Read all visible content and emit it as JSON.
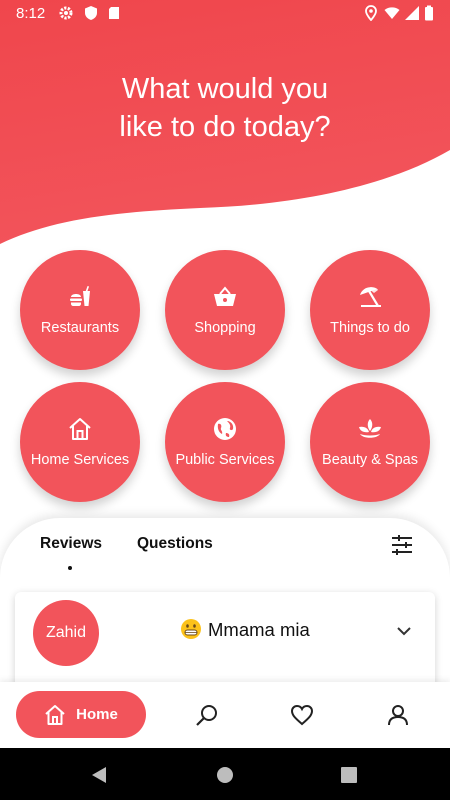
{
  "status_bar": {
    "time": "8:12"
  },
  "hero": {
    "title_line1": "What would you",
    "title_line2": "like to do today?",
    "color_top": "#f0464c",
    "color_bottom": "#f2545b"
  },
  "categories": [
    {
      "label": "Restaurants",
      "icon": "burger-drink-icon"
    },
    {
      "label": "Shopping",
      "icon": "shopping-basket-icon"
    },
    {
      "label": "Things to do",
      "icon": "beach-umbrella-icon"
    },
    {
      "label": "Home Services",
      "icon": "house-icon"
    },
    {
      "label": "Public Services",
      "icon": "globe-icon"
    },
    {
      "label": "Beauty & Spas",
      "icon": "lotus-icon"
    }
  ],
  "tabs": {
    "reviews": "Reviews",
    "questions": "Questions",
    "active": "Reviews"
  },
  "review": {
    "author": "Zahid",
    "title": "Mmama mia",
    "emoji": "grinning-face-icon"
  },
  "bottom_nav": {
    "home_label": "Home",
    "items": [
      "home-icon",
      "search-icon",
      "heart-icon",
      "profile-icon"
    ]
  },
  "accent_color": "#f2545b"
}
